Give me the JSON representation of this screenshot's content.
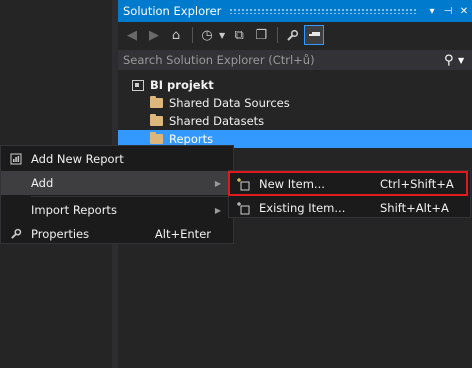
{
  "solution_explorer": {
    "title": "Solution Explorer",
    "title_buttons": [
      "▾",
      "⊣",
      "✕"
    ],
    "search_placeholder": "Search Solution Explorer (Ctrl+ů)",
    "tree": {
      "root": "BI projekt",
      "children": [
        "Shared Data Sources",
        "Shared Datasets",
        "Reports"
      ],
      "selected": "Reports"
    }
  },
  "context_menu": {
    "items": [
      {
        "icon": "add-report-icon",
        "label": "Add New Report",
        "shortcut": ""
      },
      {
        "icon": "",
        "label": "Add",
        "shortcut": "",
        "submenu": true,
        "highlighted": true
      },
      {
        "icon": "",
        "label": "Import Reports",
        "shortcut": "",
        "submenu": true
      },
      {
        "icon": "wrench-icon",
        "label": "Properties",
        "shortcut": "Alt+Enter"
      }
    ]
  },
  "submenu": {
    "items": [
      {
        "icon": "new-item-icon",
        "label": "New Item...",
        "shortcut": "Ctrl+Shift+A"
      },
      {
        "icon": "existing-item-icon",
        "label": "Existing Item...",
        "shortcut": "Shift+Alt+A"
      }
    ]
  },
  "colors": {
    "accent": "#007acc",
    "selection": "#3399ff",
    "highlight_border": "#e0191f",
    "folder": "#dcb67a"
  }
}
